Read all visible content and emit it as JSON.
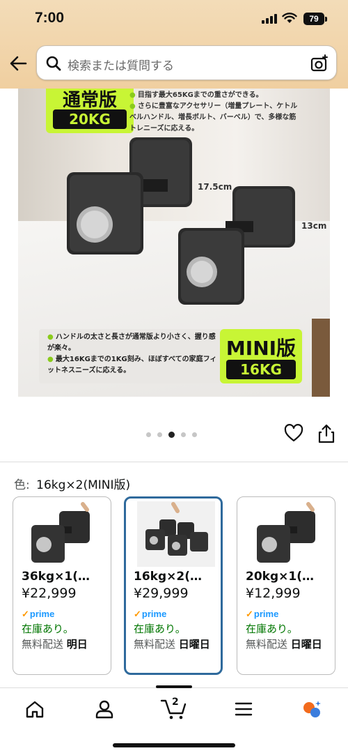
{
  "status": {
    "time": "7:00",
    "battery": "79"
  },
  "search": {
    "placeholder": "検索または質問する"
  },
  "hero": {
    "badge_top_title": "通常版",
    "badge_top_weight": "20KG",
    "features_top": [
      "目指す最大65KGまでの重さができる。",
      "さらに豊富なアクセサリー（増量プレート、ケトルベルハンドル、増長ボルト、バーベル）で、多様な筋トレニーズに応える。"
    ],
    "dim_large": "17.5cm",
    "dim_small": "13cm",
    "features_bottom": [
      "ハンドルの太さと長さが通常版より小さく、握り感が楽々。",
      "最大16KGまでの1KG刻み、ほぼすべての家庭フィットネスニーズに応える。"
    ],
    "badge_bottom_title": "MINI版",
    "badge_bottom_weight": "16KG",
    "carousel_total": 5,
    "carousel_active": 3
  },
  "color": {
    "label": "色:",
    "value": "16kg×2(MINI版)"
  },
  "variants": [
    {
      "name": "36kg×1(…",
      "price": "¥22,999",
      "prime": "prime",
      "stock": "在庫あり。",
      "ship_prefix": "無料配送",
      "ship_day": "明日",
      "selected": false
    },
    {
      "name": "16kg×2(…",
      "price": "¥29,999",
      "prime": "prime",
      "stock": "在庫あり。",
      "ship_prefix": "無料配送",
      "ship_day": "日曜日",
      "selected": true
    },
    {
      "name": "20kg×1(…",
      "price": "¥12,999",
      "prime": "prime",
      "stock": "在庫あり。",
      "ship_prefix": "無料配送",
      "ship_day": "日曜日",
      "selected": false
    }
  ],
  "nav": {
    "cart_count": "2"
  },
  "colors": {
    "accent_lime": "#c8f535",
    "selected_border": "#2f6a9c",
    "stock_green": "#007600",
    "prime_blue": "#1a98ff"
  }
}
